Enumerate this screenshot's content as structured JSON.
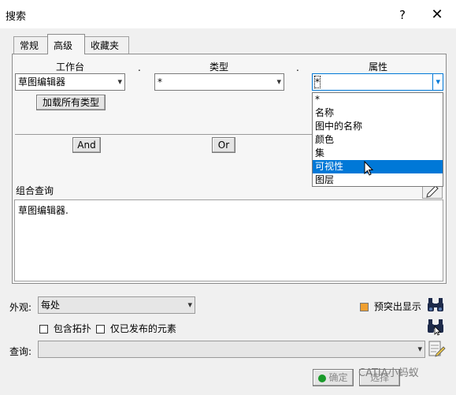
{
  "window": {
    "title": "搜索",
    "help": "?",
    "close": "✕"
  },
  "tabs": [
    {
      "label": "常规",
      "active": false
    },
    {
      "label": "高级",
      "active": true
    },
    {
      "label": "收藏夹",
      "active": false
    }
  ],
  "columns": {
    "workbench": {
      "header": "工作台",
      "value": "草图编辑器",
      "load_button": "加载所有类型"
    },
    "type": {
      "header": "类型",
      "value": "*"
    },
    "attribute": {
      "header": "属性",
      "value": "*"
    }
  },
  "separator_dot": ".",
  "attribute_options": [
    {
      "label": "*",
      "selected": false
    },
    {
      "label": "名称",
      "selected": false
    },
    {
      "label": "图中的名称",
      "selected": false
    },
    {
      "label": "颜色",
      "selected": false
    },
    {
      "label": "集",
      "selected": false
    },
    {
      "label": "可视性",
      "selected": true
    },
    {
      "label": "图层",
      "selected": false
    }
  ],
  "logic_buttons": {
    "and": "And",
    "or": "Or"
  },
  "composite_query": {
    "label": "组合查询",
    "text": "草图编辑器."
  },
  "appearance": {
    "label": "外观:",
    "value": "每处"
  },
  "highlight": {
    "label": "预突出显示",
    "checked": true
  },
  "include_topology": {
    "label": "包含拓扑",
    "checked": false
  },
  "published_only": {
    "label": "仅已发布的元素",
    "checked": false
  },
  "query": {
    "label": "查询:",
    "value": ""
  },
  "footer": {
    "ok": "确定",
    "select": "选择"
  },
  "watermark": "CATIA小蚂蚁",
  "colors": {
    "accent": "#0078d7",
    "checkbox_checked": "#f0a030",
    "ok_icon": "#1a9a2a"
  },
  "icons": {
    "search": "binoculars-icon",
    "search_select": "binoculars-cursor-icon",
    "edit": "pencil-icon",
    "query_edit": "notebook-pencil-icon",
    "cursor": "mouse-pointer-icon"
  }
}
